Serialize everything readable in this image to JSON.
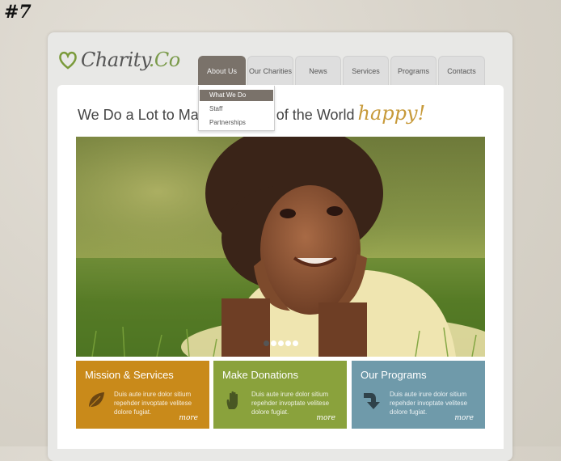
{
  "corner_tag": "#7",
  "logo": {
    "name_part": "Charity",
    "suffix_part": ".Co"
  },
  "nav": {
    "tabs": [
      {
        "label": "About Us",
        "active": true
      },
      {
        "label": "Our Charities"
      },
      {
        "label": "News"
      },
      {
        "label": "Services"
      },
      {
        "label": "Programs"
      },
      {
        "label": "Contacts"
      }
    ],
    "dropdown": [
      "What We Do",
      "Staff",
      "Partnerships"
    ]
  },
  "headline": {
    "text": "We Do a Lot to Make Children of the World",
    "emphasis": "happy!"
  },
  "slider": {
    "count": 5,
    "active_index": 0
  },
  "boxes": [
    {
      "title": "Mission & Services",
      "text": "Duis aute irure dolor sitium repehder invoptate velitese dolore fugiat.",
      "more": "more",
      "color": "#c98a1a",
      "icon": "leaf-icon"
    },
    {
      "title": "Make Donations",
      "text": "Duis aute irure dolor sitium repehder invoptate velitese dolore fugiat.",
      "more": "more",
      "color": "#8aa23c",
      "icon": "hand-icon"
    },
    {
      "title": "Our Programs",
      "text": "Duis aute irure dolor sitium repehder invoptate velitese dolore fugiat.",
      "more": "more",
      "color": "#6f9aaa",
      "icon": "arrow-down-right-icon"
    }
  ]
}
